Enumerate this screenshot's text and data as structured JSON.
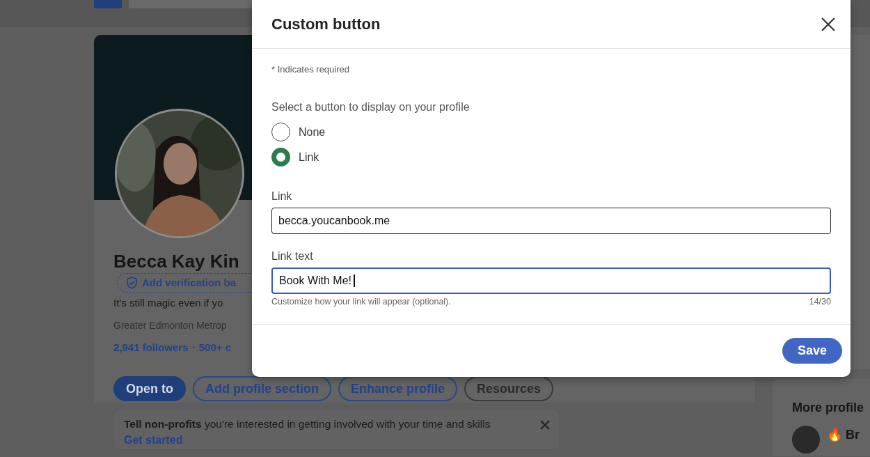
{
  "profile": {
    "name": "Becca Kay Kin",
    "verification": "Add verification ba",
    "headline": "It’s still magic even if yo",
    "location": "Greater Edmonton Metrop",
    "followers": "2,941 followers",
    "connections": "· 500+ c",
    "actions": [
      {
        "label": "Open to",
        "kind": "primary"
      },
      {
        "label": "Add profile section",
        "kind": "outline"
      },
      {
        "label": "Enhance profile",
        "kind": "outline"
      },
      {
        "label": "Resources",
        "kind": "neutral"
      }
    ],
    "prompt": {
      "text": "**Tell non-profits** you're interested in getting involved with your time and skills",
      "link": "Get started"
    }
  },
  "sidebar": {
    "card_title": "More profile",
    "person": "🔥 Br"
  },
  "dialog": {
    "title": "Custom button",
    "required_note": "* Indicates required",
    "question": "Select a button to display on your profile",
    "options": [
      {
        "label": "None",
        "selected": false
      },
      {
        "label": "Link",
        "selected": true
      }
    ],
    "fields": [
      {
        "label": "Link",
        "value": "becca.youcanbook.me",
        "focused": false
      },
      {
        "label": "Link text",
        "value": "Book With Me!",
        "focused": true,
        "hint": "Customize how your link will appear (optional).",
        "counter": "14/30"
      }
    ],
    "save": "Save"
  }
}
